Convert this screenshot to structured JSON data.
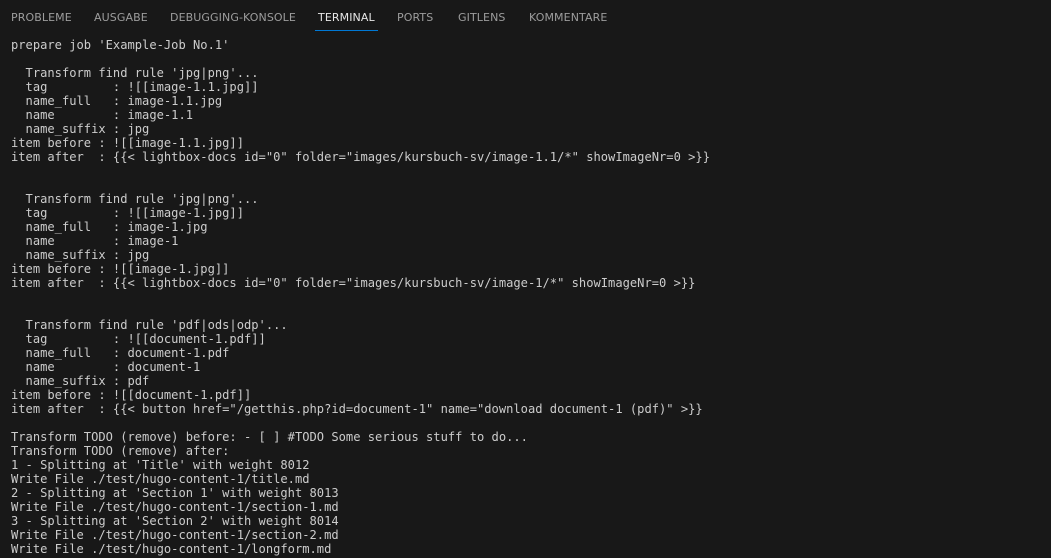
{
  "panel": {
    "tabs": [
      {
        "label": "PROBLEME",
        "active": false
      },
      {
        "label": "AUSGABE",
        "active": false
      },
      {
        "label": "DEBUGGING-KONSOLE",
        "active": false
      },
      {
        "label": "TERMINAL",
        "active": true
      },
      {
        "label": "PORTS",
        "active": false
      },
      {
        "label": "GITLENS",
        "active": false
      },
      {
        "label": "KOMMENTARE",
        "active": false
      }
    ]
  },
  "colors": {
    "background": "#181818",
    "text": "#cccccc",
    "tab_inactive": "#9d9d9d",
    "tab_active": "#e7e7e7",
    "tab_active_underline": "#0078d4"
  },
  "terminal": {
    "lines": [
      "prepare job 'Example-Job No.1'",
      "",
      "  Transform find rule 'jpg|png'...",
      "  tag         : ![[image-1.1.jpg]]",
      "  name_full   : image-1.1.jpg",
      "  name        : image-1.1",
      "  name_suffix : jpg",
      "item before : ![[image-1.1.jpg]]",
      "item after  : {{< lightbox-docs id=\"0\" folder=\"images/kursbuch-sv/image-1.1/*\" showImageNr=0 >}}",
      "",
      "",
      "  Transform find rule 'jpg|png'...",
      "  tag         : ![[image-1.jpg]]",
      "  name_full   : image-1.jpg",
      "  name        : image-1",
      "  name_suffix : jpg",
      "item before : ![[image-1.jpg]]",
      "item after  : {{< lightbox-docs id=\"0\" folder=\"images/kursbuch-sv/image-1/*\" showImageNr=0 >}}",
      "",
      "",
      "  Transform find rule 'pdf|ods|odp'...",
      "  tag         : ![[document-1.pdf]]",
      "  name_full   : document-1.pdf",
      "  name        : document-1",
      "  name_suffix : pdf",
      "item before : ![[document-1.pdf]]",
      "item after  : {{< button href=\"/getthis.php?id=document-1\" name=\"download document-1 (pdf)\" >}}",
      "",
      "Transform TODO (remove) before: - [ ] #TODO Some serious stuff to do...",
      "Transform TODO (remove) after:",
      "1 - Splitting at 'Title' with weight 8012",
      "Write File ./test/hugo-content-1/title.md",
      "2 - Splitting at 'Section 1' with weight 8013",
      "Write File ./test/hugo-content-1/section-1.md",
      "3 - Splitting at 'Section 2' with weight 8014",
      "Write File ./test/hugo-content-1/section-2.md",
      "Write File ./test/hugo-content-1/longform.md"
    ]
  }
}
